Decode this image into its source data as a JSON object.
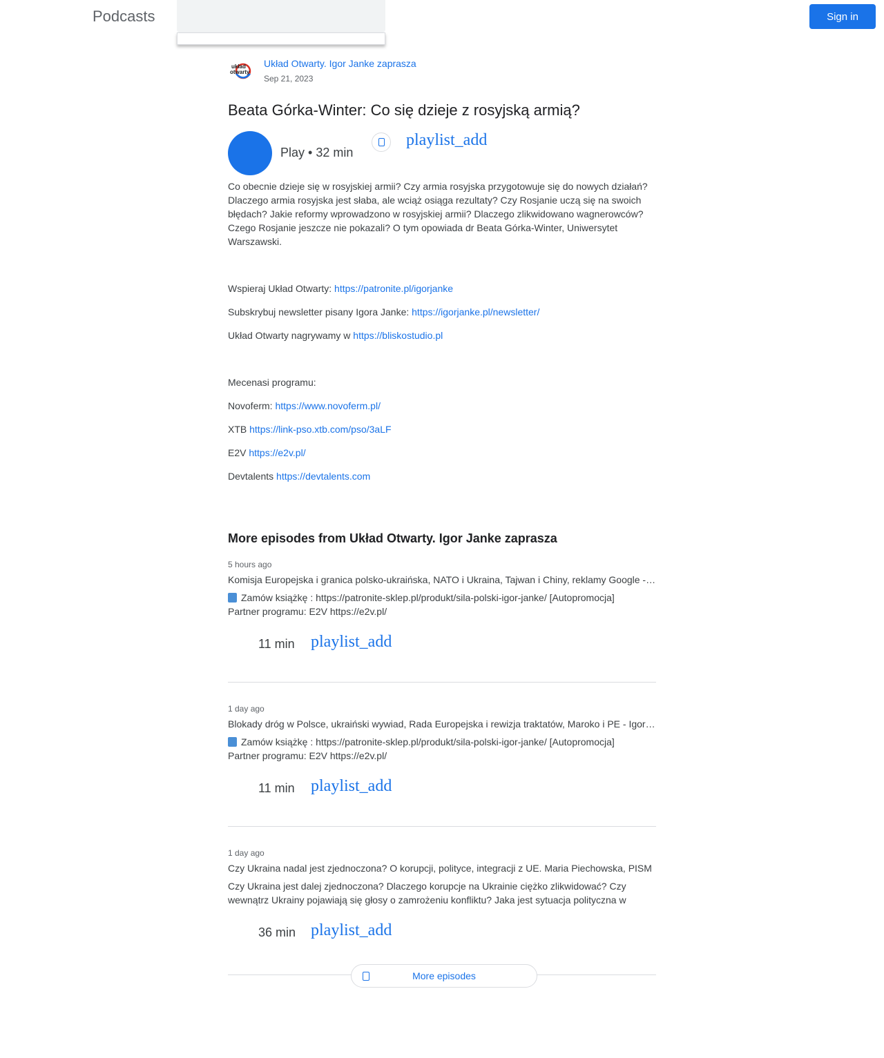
{
  "header": {
    "brand": "Podcasts",
    "sign_in_label": "Sign in"
  },
  "episode": {
    "show_name": "Układ Otwarty. Igor Janke zaprasza",
    "logo_text": "układ otwarty",
    "date": "Sep 21, 2023",
    "title": "Beata Górka-Winter: Co się dzieje z rosyjską armią?",
    "play_label": "Play • 32 min",
    "playlist_label": "playlist_add",
    "description": "Co obecnie dzieje się w rosyjskiej armii? Czy armia rosyjska przygotowuje się do nowych działań? Dlaczego armia rosyjska jest słaba, ale wciąż osiąga rezultaty? Czy Rosjanie uczą się na swoich błędach? Jakie reformy wprowadzono w rosyjskiej armii? Dlaczego zlikwidowano wagnerowców? Czego Rosjanie jeszcze nie pokazali? O tym opowiada dr Beata Górka-Winter, Uniwersytet Warszawski.",
    "links": [
      {
        "prefix": "Wspieraj Układ Otwarty: ",
        "url": "https://patronite.pl/igorjanke"
      },
      {
        "prefix": "Subskrybuj newsletter pisany Igora Janke: ",
        "url": "https://igorjanke.pl/newsletter/"
      },
      {
        "prefix": "Układ Otwarty nagrywamy w ",
        "url": "https://bliskostudio.pl"
      }
    ],
    "sponsors_heading": "Mecenasi programu:",
    "sponsors": [
      {
        "prefix": "Novoferm: ",
        "url": "https://www.novoferm.pl/"
      },
      {
        "prefix": "XTB ",
        "url": "https://link-pso.xtb.com/pso/3aLF"
      },
      {
        "prefix": "E2V ",
        "url": "https://e2v.pl/"
      },
      {
        "prefix": "Devtalents ",
        "url": "https://devtalents.com"
      }
    ]
  },
  "more_episodes": {
    "heading": "More episodes from Układ Otwarty. Igor Janke zaprasza",
    "items": [
      {
        "ago": "5 hours ago",
        "title": "Komisja Europejska i granica polsko-ukraińska, NATO i Ukraina, Tajwan i Chiny, reklamy Google - Igor Janke",
        "desc_line1": "Zamów książkę : https://patronite-sklep.pl/produkt/sila-polski-igor-janke/ [Autopromocja]",
        "desc_line2": "Partner programu: E2V https://e2v.pl/",
        "duration": "11 min",
        "playlist_label": "playlist_add"
      },
      {
        "ago": "1 day ago",
        "title": "Blokady dróg w Polsce, ukraiński wywiad, Rada Europejska i rewizja traktatów, Maroko i PE - Igor Janke",
        "desc_line1": "Zamów książkę : https://patronite-sklep.pl/produkt/sila-polski-igor-janke/ [Autopromocja]",
        "desc_line2": "Partner programu: E2V https://e2v.pl/",
        "duration": "11 min",
        "playlist_label": "playlist_add"
      },
      {
        "ago": "1 day ago",
        "title": "Czy Ukraina nadal jest zjednoczona? O korupcji, polityce, integracji z UE. Maria Piechowska, PISM",
        "desc_line1": "Czy Ukraina jest dalej zjednoczona? Dlaczego korupcje na Ukrainie ciężko zlikwidować? Czy",
        "desc_line2": "wewnątrz Ukrainy pojawiają się głosy o zamrożeniu konfliktu? Jaka jest sytuacja polityczna w",
        "duration": "36 min",
        "playlist_label": "playlist_add"
      }
    ],
    "more_button_label": "More episodes"
  },
  "colors": {
    "accent": "#1a73e8",
    "text": "#202124",
    "secondary_text": "#5f6368",
    "divider": "#dadce0"
  },
  "icons": {
    "share": "share-icon",
    "book": "book-emoji-icon",
    "more": "subscriptions-icon"
  }
}
